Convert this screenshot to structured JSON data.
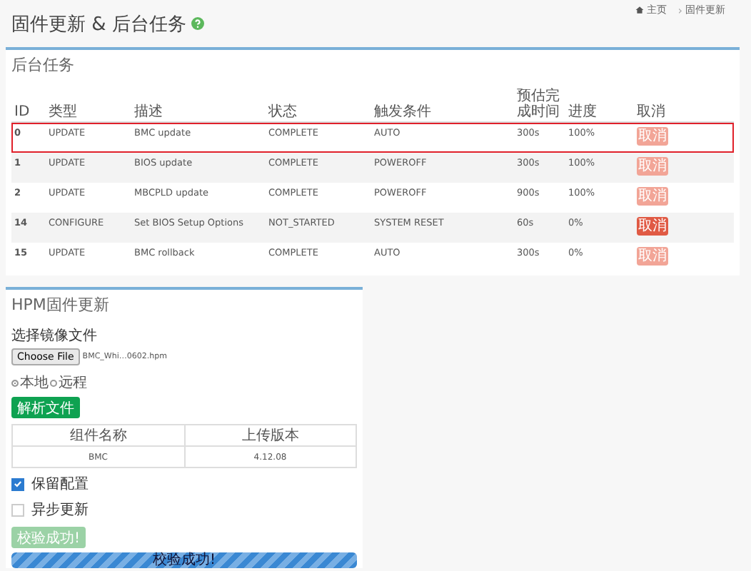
{
  "page": {
    "title": "固件更新 & 后台任务",
    "breadcrumb": [
      "主页",
      "固件更新"
    ],
    "breadcrumb_separator": "›"
  },
  "tasks": {
    "title": "后台任务",
    "columns": [
      "ID",
      "类型",
      "描述",
      "状态",
      "触发条件",
      "预估完成时间",
      "进度",
      "取消"
    ],
    "rows": [
      {
        "id": "0",
        "type": "UPDATE",
        "desc": "BMC update",
        "status": "COMPLETE",
        "trigger": "AUTO",
        "time": "300s",
        "progress": "100%",
        "cancel": "取消",
        "cancel_disabled": true,
        "highlighted": true
      },
      {
        "id": "1",
        "type": "UPDATE",
        "desc": "BIOS update",
        "status": "COMPLETE",
        "trigger": "POWEROFF",
        "time": "300s",
        "progress": "100%",
        "cancel": "取消",
        "cancel_disabled": true,
        "highlighted": false
      },
      {
        "id": "2",
        "type": "UPDATE",
        "desc": "MBCPLD update",
        "status": "COMPLETE",
        "trigger": "POWEROFF",
        "time": "900s",
        "progress": "100%",
        "cancel": "取消",
        "cancel_disabled": true,
        "highlighted": false
      },
      {
        "id": "14",
        "type": "CONFIGURE",
        "desc": "Set BIOS Setup Options",
        "status": "NOT_STARTED",
        "trigger": "SYSTEM RESET",
        "time": "60s",
        "progress": "0%",
        "cancel": "取消",
        "cancel_disabled": false,
        "highlighted": false
      },
      {
        "id": "15",
        "type": "UPDATE",
        "desc": "BMC rollback",
        "status": "COMPLETE",
        "trigger": "AUTO",
        "time": "300s",
        "progress": "0%",
        "cancel": "取消",
        "cancel_disabled": true,
        "highlighted": false
      }
    ]
  },
  "hpm": {
    "title": "HPM固件更新",
    "file_label": "选择镜像文件",
    "file_button": "Choose File",
    "file_name": "BMC_Whi…0602.hpm",
    "sources": [
      {
        "label": "本地",
        "selected": true
      },
      {
        "label": "远程",
        "selected": false
      }
    ],
    "parse_button": "解析文件",
    "components": {
      "columns": [
        "组件名称",
        "上传版本"
      ],
      "rows": [
        [
          "BMC",
          "4.12.08"
        ]
      ]
    },
    "options": [
      {
        "label": "保留配置",
        "checked": true
      },
      {
        "label": "异步更新",
        "checked": false
      }
    ],
    "verify_button": {
      "label": "校验成功!",
      "disabled": true
    },
    "progress": {
      "level": 1.0,
      "text": "校验成功!"
    }
  }
}
